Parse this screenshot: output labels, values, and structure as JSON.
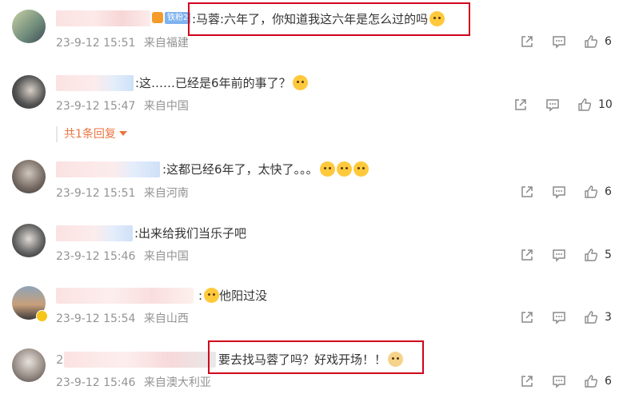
{
  "comments": [
    {
      "text": ":马蓉:六年了，你知道我这六年是怎么过的吗",
      "emoji": [
        "hug-emoji"
      ],
      "date": "23-9-12 15:51",
      "location": "来自福建",
      "likes": "6",
      "badge": "铁粉2"
    },
    {
      "text": ":这……已经是6年前的事了？",
      "emoji": [
        "shock-emoji"
      ],
      "date": "23-9-12 15:47",
      "location": "来自中国",
      "likes": "10",
      "replies": "共1条回复"
    },
    {
      "text": ":这都已经6年了，太快了。。。",
      "emoji": [
        "cry-emoji",
        "cry-emoji",
        "cry-emoji"
      ],
      "date": "23-9-12 15:51",
      "location": "来自河南",
      "likes": "6"
    },
    {
      "text": ":出来给我们当乐子吧",
      "emoji": [],
      "date": "23-9-12 15:46",
      "location": "来自中国",
      "likes": "5"
    },
    {
      "text": "他阳过没",
      "prefix": ":",
      "emoji": [
        "think-emoji"
      ],
      "date": "23-9-12 15:54",
      "location": "来自山西",
      "likes": "3"
    },
    {
      "text": "要去找马蓉了吗？好戏开场！！",
      "name_prefix": "2",
      "emoji": [
        "dog-emoji"
      ],
      "date": "23-9-12 15:46",
      "location": "来自澳大利亚",
      "likes": "6"
    }
  ],
  "colors": {
    "highlight_box": "#d0021b",
    "reply_link": "#eb7340",
    "meta": "#939393"
  },
  "icons": [
    "share-icon",
    "comment-icon",
    "like-icon",
    "chevron-down-icon"
  ]
}
